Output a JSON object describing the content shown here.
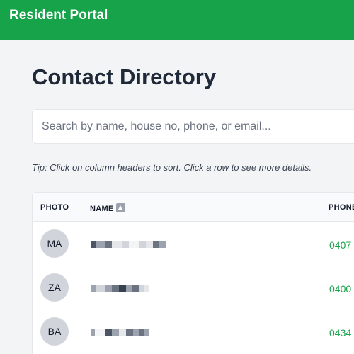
{
  "header": {
    "brand": "Resident Portal",
    "color": "#16a34a"
  },
  "page": {
    "title": "Contact Directory"
  },
  "search": {
    "placeholder": "Search by name, house no, phone, or email..."
  },
  "tip": "Tip: Click on column headers to sort. Click a row to see more details.",
  "table": {
    "columns": {
      "photo": "PHOTO",
      "name": "NAME",
      "phone": "PHONE"
    },
    "sort_icon": "sort-ascending-icon",
    "rows": [
      {
        "initials": "MA",
        "name_redacted": true,
        "phone": "0407"
      },
      {
        "initials": "ZA",
        "name_redacted": true,
        "phone": "0400"
      },
      {
        "initials": "BA",
        "name_redacted": true,
        "phone": "0434"
      }
    ]
  }
}
